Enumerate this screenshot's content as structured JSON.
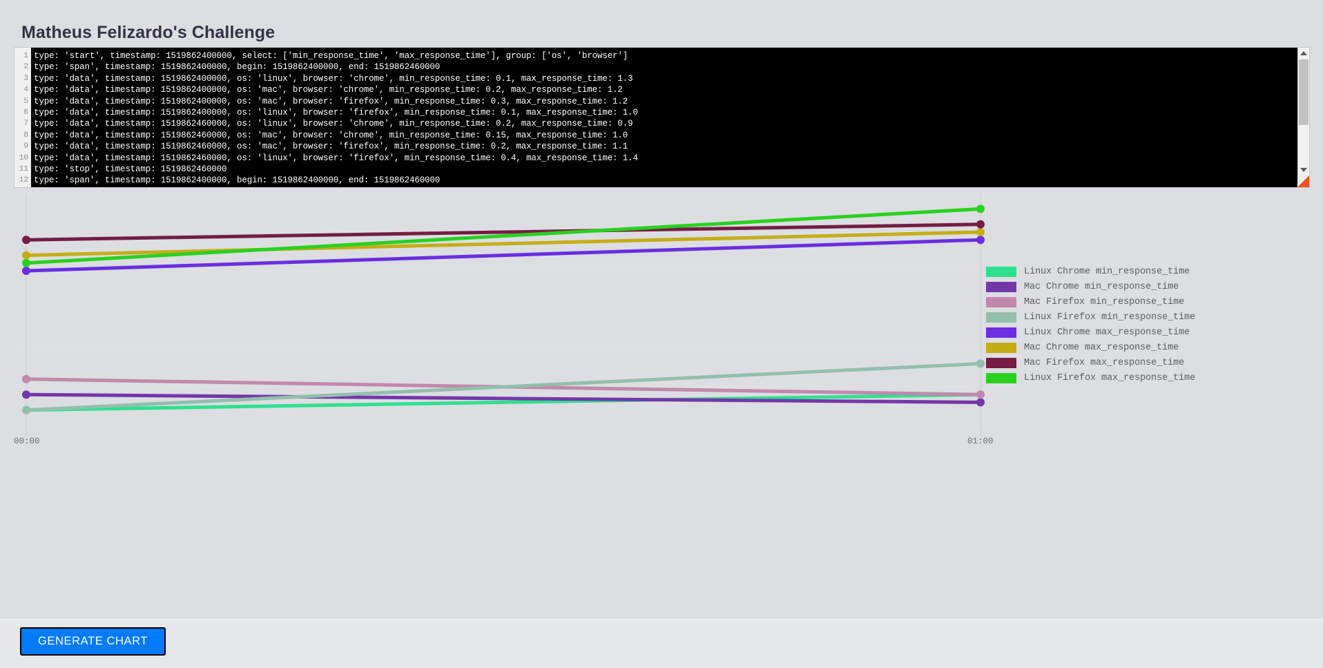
{
  "header": {
    "title": "Matheus Felizardo's Challenge"
  },
  "editor": {
    "line_numbers": [
      "1",
      "2",
      "3",
      "4",
      "5",
      "6",
      "7",
      "8",
      "9",
      "10",
      "11",
      "12"
    ],
    "lines": [
      "type: 'start', timestamp: 1519862400000, select: ['min_response_time', 'max_response_time'], group: ['os', 'browser']",
      "type: 'span', timestamp: 1519862400000, begin: 1519862400000, end: 1519862460000",
      "type: 'data', timestamp: 1519862400000, os: 'linux', browser: 'chrome', min_response_time: 0.1, max_response_time: 1.3",
      "type: 'data', timestamp: 1519862400000, os: 'mac', browser: 'chrome', min_response_time: 0.2, max_response_time: 1.2",
      "type: 'data', timestamp: 1519862400000, os: 'mac', browser: 'firefox', min_response_time: 0.3, max_response_time: 1.2",
      "type: 'data', timestamp: 1519862400000, os: 'linux', browser: 'firefox', min_response_time: 0.1, max_response_time: 1.0",
      "type: 'data', timestamp: 1519862460000, os: 'linux', browser: 'chrome', min_response_time: 0.2, max_response_time: 0.9",
      "type: 'data', timestamp: 1519862460000, os: 'mac', browser: 'chrome', min_response_time: 0.15, max_response_time: 1.0",
      "type: 'data', timestamp: 1519862460000, os: 'mac', browser: 'firefox', min_response_time: 0.2, max_response_time: 1.1",
      "type: 'data', timestamp: 1519862460000, os: 'linux', browser: 'firefox', min_response_time: 0.4, max_response_time: 1.4",
      "type: 'stop', timestamp: 1519862460000",
      "type: 'span', timestamp: 1519862400000, begin: 1519862400000, end: 1519862460000"
    ],
    "scrollbar": {
      "up_arrow": "scroll-up",
      "down_arrow": "scroll-down"
    },
    "resize_handle": "resize-grip"
  },
  "footer": {
    "generate_label": "GENERATE CHART",
    "accent_color": "#007bff"
  },
  "chart_data": {
    "type": "line",
    "title": "",
    "xlabel": "",
    "ylabel": "",
    "x": [
      "00:00",
      "01:00"
    ],
    "tick_labels": [
      "00:00",
      "01:00"
    ],
    "grid": true,
    "legend_position": "right",
    "ylim": [
      0,
      1.5
    ],
    "series": [
      {
        "name": "Linux Chrome min_response_time",
        "color": "#2ee08e",
        "values": [
          0.1,
          0.2
        ]
      },
      {
        "name": "Mac Chrome min_response_time",
        "color": "#7437a8",
        "values": [
          0.2,
          0.15
        ]
      },
      {
        "name": "Mac Firefox min_response_time",
        "color": "#c288ac",
        "values": [
          0.3,
          0.2
        ]
      },
      {
        "name": "Linux Firefox min_response_time",
        "color": "#93bfad",
        "values": [
          0.1,
          0.4
        ]
      },
      {
        "name": "Linux Chrome max_response_time",
        "color": "#6b2ee0",
        "values": [
          1.0,
          1.2
        ]
      },
      {
        "name": "Mac Chrome max_response_time",
        "color": "#c4ad16",
        "values": [
          1.1,
          1.25
        ]
      },
      {
        "name": "Mac Firefox max_response_time",
        "color": "#751d43",
        "values": [
          1.2,
          1.3
        ]
      },
      {
        "name": "Linux Firefox max_response_time",
        "color": "#29d11f",
        "values": [
          1.05,
          1.4
        ]
      }
    ]
  }
}
